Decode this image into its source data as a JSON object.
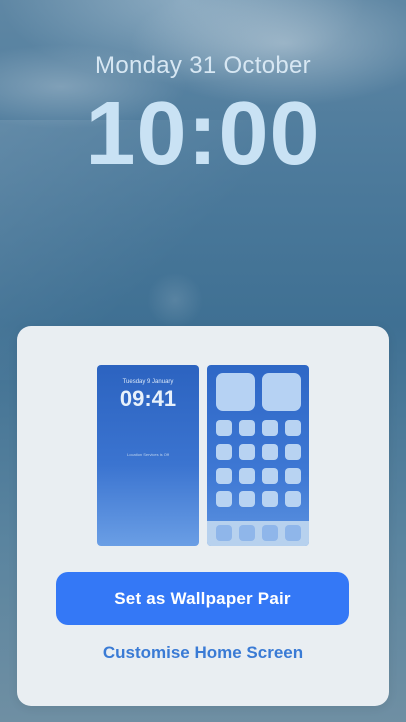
{
  "lock_screen": {
    "date": "Monday 31 October",
    "time": "10:00"
  },
  "sheet": {
    "lock_preview": {
      "date": "Tuesday 9 January",
      "time": "09:41",
      "location_text": "Location Services is Off"
    },
    "primary_button": "Set as Wallpaper Pair",
    "secondary_button": "Customise Home Screen"
  },
  "colors": {
    "accent": "#3478f6",
    "sheet_background": "#e9eef2"
  }
}
